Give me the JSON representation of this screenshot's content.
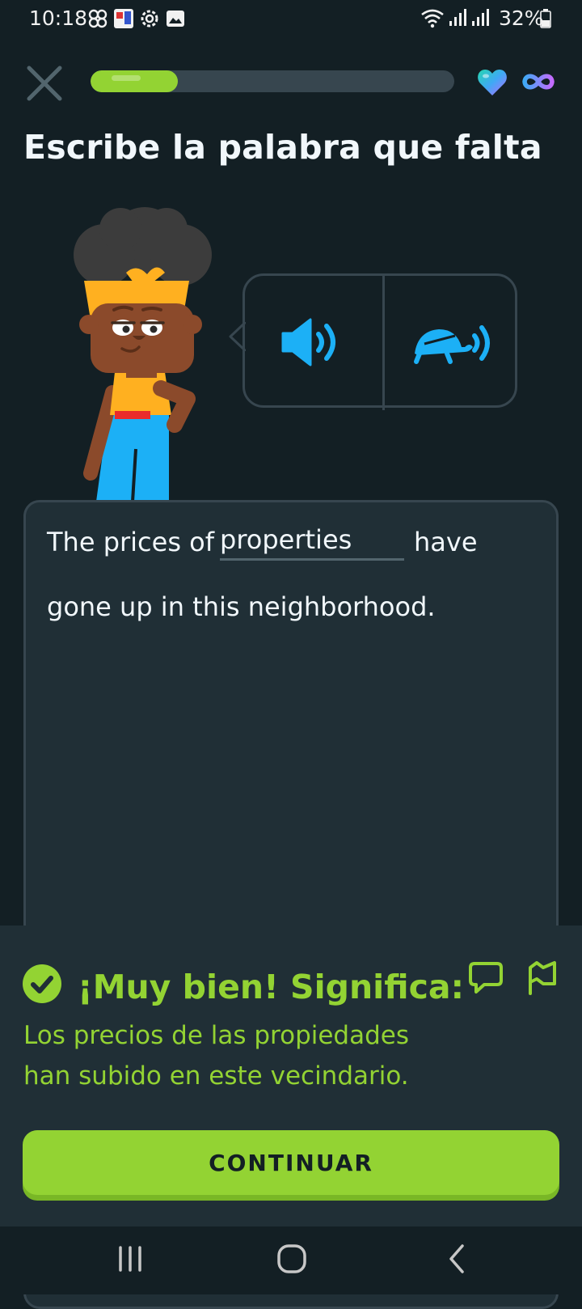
{
  "status_bar": {
    "time": "10:18",
    "battery": "32%",
    "icons": [
      "pinwheel-icon",
      "notification-app-icon",
      "gear-icon",
      "image-icon",
      "wifi-icon",
      "signal-icon",
      "signal-icon",
      "battery-icon"
    ]
  },
  "header": {
    "close_icon": "close-icon",
    "progress": 0.24,
    "hearts_icon": "heart-icon",
    "hearts_value_icon": "infinity-icon"
  },
  "exercise": {
    "title": "Escribe la palabra que falta",
    "audio_buttons": [
      "speaker-icon",
      "turtle-speaker-icon"
    ],
    "sentence": {
      "before": "The prices of",
      "answer": "properties",
      "after": "have",
      "line2": "gone up in this neighborhood."
    }
  },
  "feedback": {
    "heading": "¡Muy bien! Significa:",
    "translation_line1": "Los precios de las propiedades",
    "translation_line2": "han subido en este vecindario.",
    "continue_label": "CONTINUAR"
  },
  "colors": {
    "background": "#131f24",
    "panel": "#202f36",
    "accent_green": "#93d333",
    "audio_blue": "#1cb0f6",
    "border": "#37464f"
  }
}
